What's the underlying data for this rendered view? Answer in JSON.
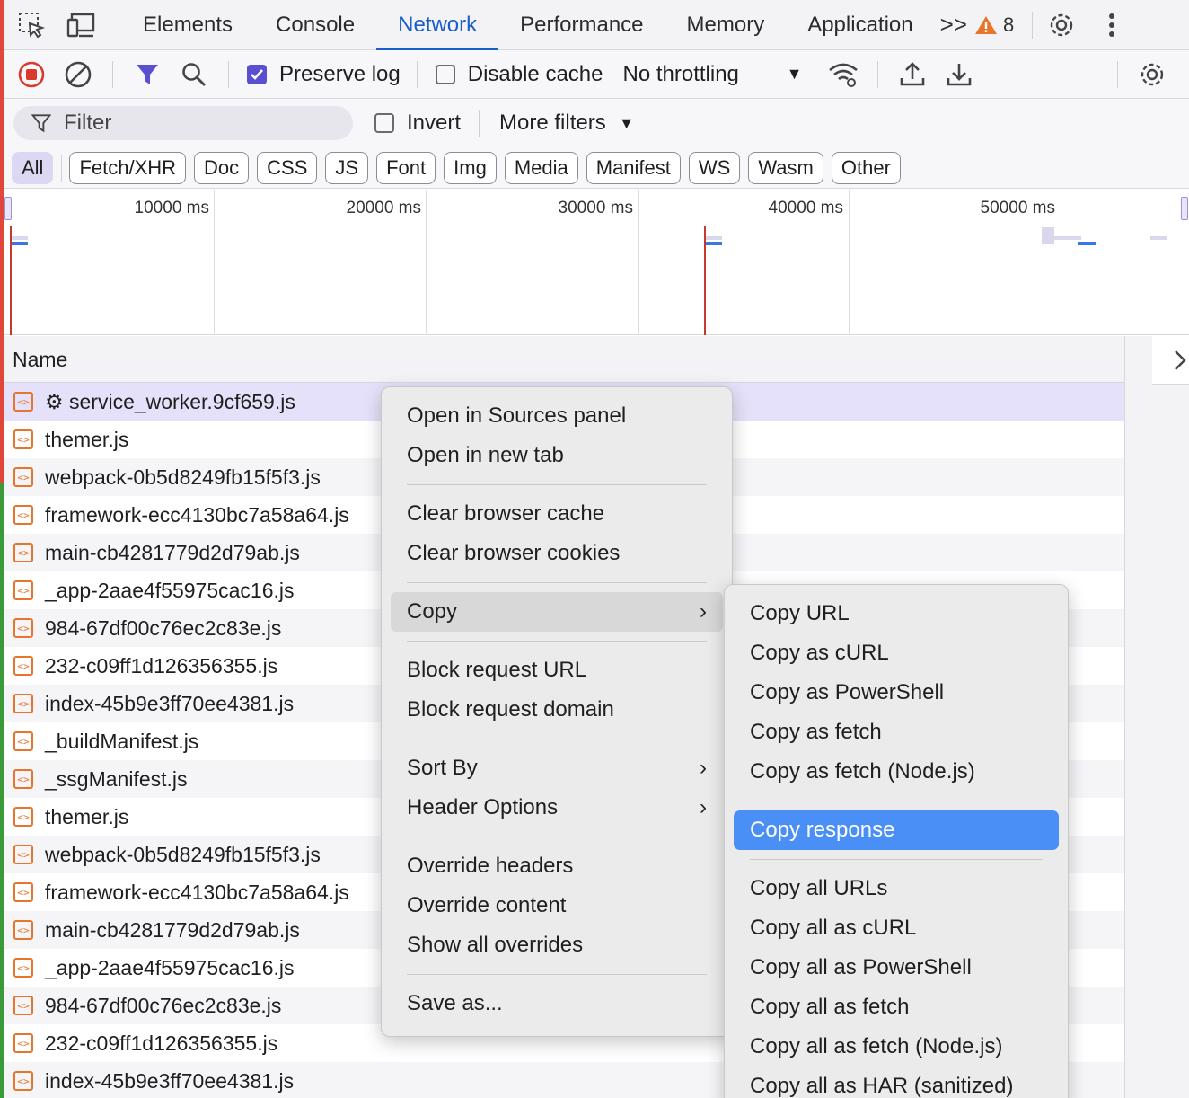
{
  "tabbar": {
    "tabs": [
      "Elements",
      "Console",
      "Network",
      "Performance",
      "Memory",
      "Application"
    ],
    "active_tab": "Network",
    "more_tabs": ">>",
    "warning_count": "8"
  },
  "toolbar": {
    "preserve_log": "Preserve log",
    "disable_cache": "Disable cache",
    "throttling": "No throttling"
  },
  "filter": {
    "placeholder": "Filter",
    "invert": "Invert",
    "more_filters": "More filters"
  },
  "types": [
    "All",
    "Fetch/XHR",
    "Doc",
    "CSS",
    "JS",
    "Font",
    "Img",
    "Media",
    "Manifest",
    "WS",
    "Wasm",
    "Other"
  ],
  "timeline": {
    "ticks": [
      "10000 ms",
      "20000 ms",
      "30000 ms",
      "40000 ms",
      "50000 ms"
    ]
  },
  "list": {
    "column_name": "Name",
    "rows": [
      "⚙ service_worker.9cf659.js",
      "themer.js",
      "webpack-0b5d8249fb15f5f3.js",
      "framework-ecc4130bc7a58a64.js",
      "main-cb4281779d2d79ab.js",
      "_app-2aae4f55975cac16.js",
      "984-67df00c76ec2c83e.js",
      "232-c09ff1d126356355.js",
      "index-45b9e3ff70ee4381.js",
      "_buildManifest.js",
      "_ssgManifest.js",
      "themer.js",
      "webpack-0b5d8249fb15f5f3.js",
      "framework-ecc4130bc7a58a64.js",
      "main-cb4281779d2d79ab.js",
      "_app-2aae4f55975cac16.js",
      "984-67df00c76ec2c83e.js",
      "232-c09ff1d126356355.js",
      "index-45b9e3ff70ee4381.js"
    ]
  },
  "context_menu": {
    "open_sources": "Open in Sources panel",
    "open_new_tab": "Open in new tab",
    "clear_cache": "Clear browser cache",
    "clear_cookies": "Clear browser cookies",
    "copy": "Copy",
    "block_url": "Block request URL",
    "block_domain": "Block request domain",
    "sort_by": "Sort By",
    "header_options": "Header Options",
    "override_headers": "Override headers",
    "override_content": "Override content",
    "show_overrides": "Show all overrides",
    "save_as": "Save as..."
  },
  "copy_menu": {
    "copy_url": "Copy URL",
    "copy_curl": "Copy as cURL",
    "copy_powershell": "Copy as PowerShell",
    "copy_fetch": "Copy as fetch",
    "copy_fetch_node": "Copy as fetch (Node.js)",
    "copy_response": "Copy response",
    "copy_all_urls": "Copy all URLs",
    "copy_all_curl": "Copy all as cURL",
    "copy_all_powershell": "Copy all as PowerShell",
    "copy_all_fetch": "Copy all as fetch",
    "copy_all_fetch_node": "Copy all as fetch (Node.js)",
    "copy_all_har": "Copy all as HAR (sanitized)"
  },
  "colors": {
    "accent": "#1a5fc9",
    "menu_highlight": "#4a8ff6",
    "record": "#d93a2c",
    "warning": "#e8752c"
  }
}
